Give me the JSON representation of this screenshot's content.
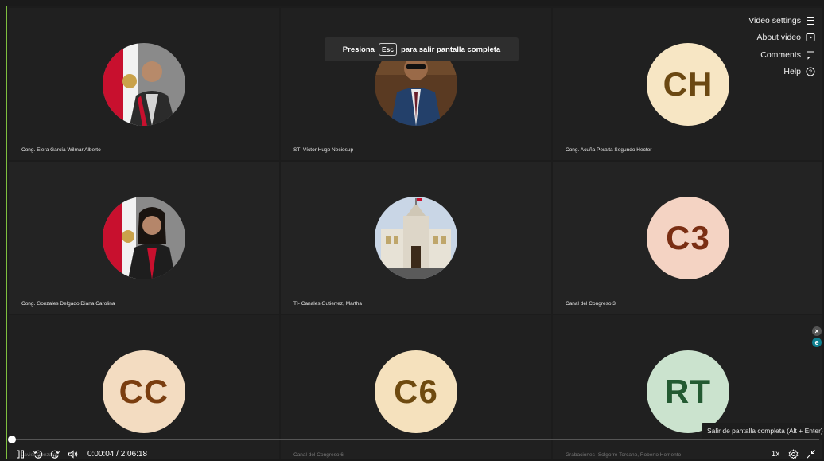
{
  "toast": {
    "prefix": "Presiona",
    "key": "Esc",
    "suffix": "para salir pantalla completa"
  },
  "menu": {
    "video_settings": "Video settings",
    "about_video": "About video",
    "comments": "Comments",
    "help": "Help"
  },
  "tiles": [
    {
      "name": "Cong. Elera García Wilmar Alberto",
      "avatar": "photo"
    },
    {
      "name": "ST- Víctor Hugo Neciosup",
      "avatar": "photo"
    },
    {
      "name": "Cong. Acuña Peralta Segundo Hector",
      "initials": "CH",
      "bg": "#f7e6c4",
      "fg": "#6b4812"
    },
    {
      "name": "Cong. Gonzales Delgado Diana Carolina",
      "avatar": "photo"
    },
    {
      "name": "TI- Canales Gutierrez, Martha",
      "avatar": "photo"
    },
    {
      "name": "Canal del Congreso 3",
      "initials": "C3",
      "bg": "#f4d3c3",
      "fg": "#7a2e13"
    },
    {
      "name": "Javier Gonzales",
      "initials": "CC",
      "bg": "#f3dcc1",
      "fg": "#7a3e10"
    },
    {
      "name": "Canal del Congreso 6",
      "initials": "C6",
      "bg": "#f5e1bd",
      "fg": "#6e4a10"
    },
    {
      "name": "Grabaciones- Solgorre Torcano, Roberto Homento",
      "initials": "RT",
      "bg": "#cbe3ce",
      "fg": "#245a32"
    }
  ],
  "tooltip": "Salir de pantalla completa (Alt + Enter)",
  "player": {
    "current_time": "0:00:04",
    "separator": "/",
    "duration": "2:06:18",
    "speed": "1x",
    "progress": 0.0005,
    "skip_back": "10",
    "skip_forward": "10"
  }
}
